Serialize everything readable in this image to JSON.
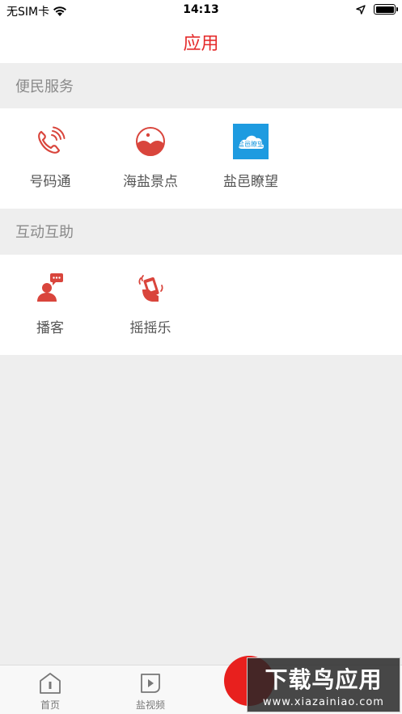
{
  "status": {
    "carrier": "无SIM卡",
    "time": "14:13"
  },
  "nav": {
    "title": "应用"
  },
  "sections": [
    {
      "title": "便民服务",
      "items": [
        {
          "label": "号码通",
          "icon": "phone-icon"
        },
        {
          "label": "海盐景点",
          "icon": "scenic-spot-icon"
        },
        {
          "label": "盐邑瞭望",
          "icon": "cloud-logo-icon",
          "logo_text": "盐邑瞭望"
        }
      ]
    },
    {
      "title": "互动互助",
      "items": [
        {
          "label": "播客",
          "icon": "podcast-user-icon"
        },
        {
          "label": "摇摇乐",
          "icon": "shake-hand-icon"
        }
      ]
    }
  ],
  "tabs": [
    {
      "label": "首页",
      "icon": "home-icon"
    },
    {
      "label": "盐视频",
      "icon": "video-icon"
    }
  ],
  "watermark": {
    "text": "下载鸟应用",
    "url": "www.xiazainiao.com"
  },
  "colors": {
    "accent": "#e52b2b",
    "icon_red": "#d9453c",
    "logo_blue": "#1e9be0"
  }
}
